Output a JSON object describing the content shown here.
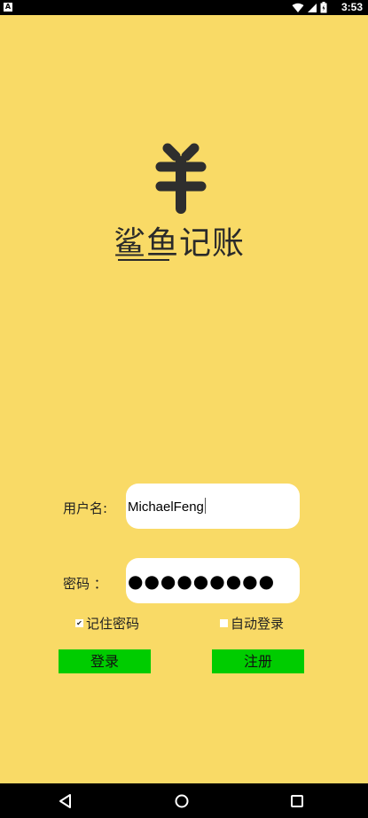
{
  "status_bar": {
    "notification_icon": "a-notification-icon",
    "notification_glyph": "A",
    "time": "3:53",
    "icons": [
      "wifi-icon",
      "signal-icon",
      "battery-icon"
    ]
  },
  "logo": {
    "icon": "yen-symbol-icon",
    "app_name": "鲨鱼记账"
  },
  "form": {
    "username_label": "用户名:",
    "username_value": "MichaelFeng",
    "password_label": "密码 ：",
    "password_masked": "●●●●●●●●●",
    "remember_label": "记住密码",
    "remember_checked": true,
    "auto_login_label": "自动登录",
    "auto_login_checked": false,
    "login_button": "登录",
    "register_button": "注册"
  },
  "nav_bar": {
    "icons": [
      "back-icon",
      "home-icon",
      "recents-icon"
    ]
  },
  "colors": {
    "background": "#F9DA66",
    "button": "#00CC00",
    "input": "#FFFFFF"
  }
}
